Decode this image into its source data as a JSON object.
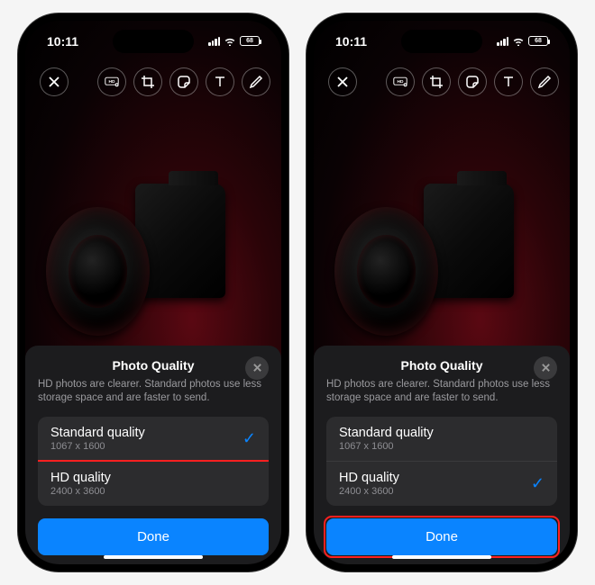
{
  "status": {
    "time": "10:11",
    "battery": "68"
  },
  "sheet": {
    "title": "Photo Quality",
    "description": "HD photos are clearer. Standard photos use less storage space and are faster to send.",
    "options": [
      {
        "label": "Standard quality",
        "resolution": "1067 x 1600"
      },
      {
        "label": "HD quality",
        "resolution": "2400 x 3600"
      }
    ],
    "done": "Done"
  },
  "phones": {
    "left": {
      "selected": 0,
      "highlight": "hd-option"
    },
    "right": {
      "selected": 1,
      "highlight": "done-button"
    }
  }
}
